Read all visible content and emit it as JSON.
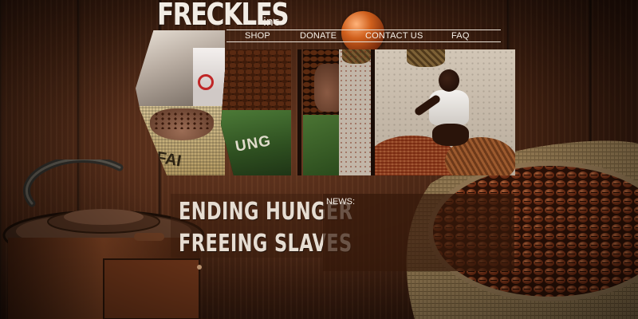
{
  "logo": {
    "main": "FRECKLES",
    "sub": "inc"
  },
  "nav": {
    "items": [
      {
        "label": "SHOP"
      },
      {
        "label": "DONATE"
      },
      {
        "label": "CONTACT US"
      },
      {
        "label": "FAQ"
      }
    ]
  },
  "collage": {
    "panel1_stamp": "FAI",
    "panel2_stamp": "UNG"
  },
  "headline": {
    "line1": "ENDING HUNGER",
    "line2": "FREEING SLAVES"
  },
  "news": {
    "label": "NEWS:"
  },
  "colors": {
    "text_light": "#f2ece4",
    "wood_dark": "#3e1f10",
    "news_panel": "#34180a"
  },
  "icons": [
    "coffee-grinder-image",
    "coffee-sack-image",
    "orange-orb-image"
  ]
}
